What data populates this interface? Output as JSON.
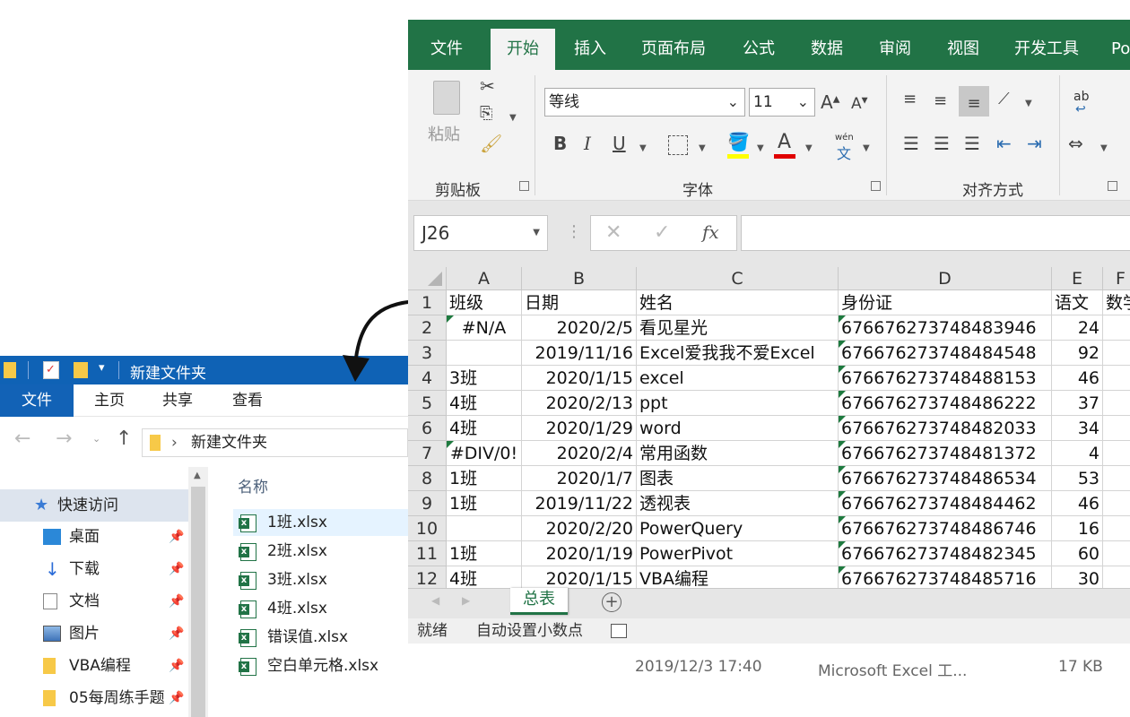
{
  "ribbon": {
    "tabs": [
      "文件",
      "开始",
      "插入",
      "页面布局",
      "公式",
      "数据",
      "审阅",
      "视图",
      "开发工具",
      "Po"
    ],
    "paste_label": "粘贴",
    "groups": {
      "clipboard": "剪贴板",
      "font": "字体",
      "alignment": "对齐方式"
    },
    "font_name": "等线",
    "font_size": "11",
    "phonetic_label": "wén",
    "phonetic_char": "文",
    "wrap_label": "ab"
  },
  "formula_bar": {
    "name_box": "J26",
    "fx": "fx"
  },
  "grid": {
    "columns": [
      "A",
      "B",
      "C",
      "D",
      "E",
      "F"
    ],
    "rows": [
      {
        "n": "1",
        "a": "班级",
        "b": "日期",
        "c": "姓名",
        "d": "身份证",
        "e": "语文",
        "f": "数学"
      },
      {
        "n": "2",
        "a": "#N/A",
        "b": "2020/2/5",
        "c": "看见星光",
        "d": "676676273748483946",
        "e": "24",
        "f": ""
      },
      {
        "n": "3",
        "a": "",
        "b": "2019/11/16",
        "c": "Excel爱我我不爱Excel",
        "d": "676676273748484548",
        "e": "92",
        "f": ""
      },
      {
        "n": "4",
        "a": "3班",
        "b": "2020/1/15",
        "c": "excel",
        "d": "676676273748488153",
        "e": "46",
        "f": ""
      },
      {
        "n": "5",
        "a": "4班",
        "b": "2020/2/13",
        "c": "ppt",
        "d": "676676273748486222",
        "e": "37",
        "f": ""
      },
      {
        "n": "6",
        "a": "4班",
        "b": "2020/1/29",
        "c": "word",
        "d": "676676273748482033",
        "e": "34",
        "f": ""
      },
      {
        "n": "7",
        "a": "#DIV/0!",
        "b": "2020/2/4",
        "c": "常用函数",
        "d": "676676273748481372",
        "e": "4",
        "f": ""
      },
      {
        "n": "8",
        "a": "1班",
        "b": "2020/1/7",
        "c": "图表",
        "d": "676676273748486534",
        "e": "53",
        "f": ""
      },
      {
        "n": "9",
        "a": "1班",
        "b": "2019/11/22",
        "c": "透视表",
        "d": "676676273748484462",
        "e": "46",
        "f": ""
      },
      {
        "n": "10",
        "a": "",
        "b": "2020/2/20",
        "c": "PowerQuery",
        "d": "676676273748486746",
        "e": "16",
        "f": ""
      },
      {
        "n": "11",
        "a": "1班",
        "b": "2020/1/19",
        "c": "PowerPivot",
        "d": "676676273748482345",
        "e": "60",
        "f": ""
      },
      {
        "n": "12",
        "a": "4班",
        "b": "2020/1/15",
        "c": "VBA编程",
        "d": "676676273748485716",
        "e": "30",
        "f": ""
      }
    ]
  },
  "sheets": {
    "active": "总表",
    "add": "+"
  },
  "status": {
    "ready": "就绪",
    "auto_decimal": "自动设置小数点"
  },
  "explorer": {
    "title": "新建文件夹",
    "tabs": [
      "文件",
      "主页",
      "共享",
      "查看"
    ],
    "address": "新建文件夹",
    "nav": [
      {
        "label": "快速访问",
        "pinned": false
      },
      {
        "label": "桌面",
        "pinned": true
      },
      {
        "label": "下载",
        "pinned": true
      },
      {
        "label": "文档",
        "pinned": true
      },
      {
        "label": "图片",
        "pinned": true
      },
      {
        "label": "VBA编程",
        "pinned": true
      },
      {
        "label": "05每周练手题",
        "pinned": true
      }
    ],
    "column_name": "名称",
    "files": [
      "1班.xlsx",
      "2班.xlsx",
      "3班.xlsx",
      "4班.xlsx",
      "错误值.xlsx",
      "空白单元格.xlsx"
    ],
    "behind_row": {
      "date": "2019/12/3 17:40",
      "type": "Microsoft Excel 工...",
      "size": "17 KB"
    }
  },
  "colors": {
    "excel_green": "#217346",
    "explorer_blue": "#0f62b5",
    "triangle": "#1e7a3f"
  }
}
